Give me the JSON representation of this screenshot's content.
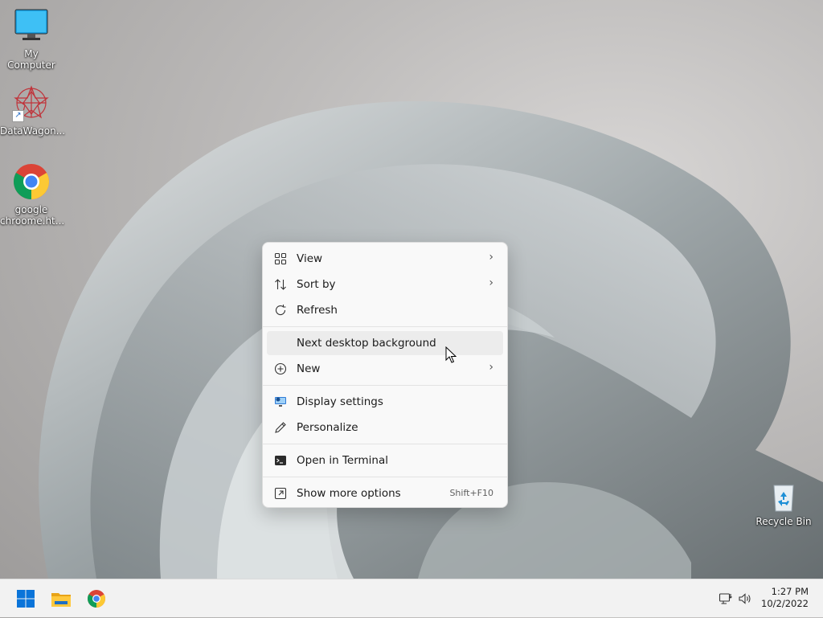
{
  "desktop": {
    "icons": [
      {
        "label": "My Computer",
        "icon": "monitor-icon"
      },
      {
        "label": "DataWagon...",
        "icon": "datawagon-logo-icon"
      },
      {
        "label": "google\nchroome.ht...",
        "label_line1": "google",
        "label_line2": "chroome.ht...",
        "icon": "chrome-icon"
      },
      {
        "label": "Recycle Bin",
        "icon": "recycle-bin-icon"
      }
    ]
  },
  "context_menu": {
    "items": [
      {
        "label": "View",
        "icon": "grid-icon",
        "submenu": true
      },
      {
        "label": "Sort by",
        "icon": "sort-arrows-icon",
        "submenu": true
      },
      {
        "label": "Refresh",
        "icon": "refresh-icon",
        "submenu": false
      },
      {
        "label": "Next desktop background",
        "icon": "",
        "submenu": false,
        "hovered": true
      },
      {
        "label": "New",
        "icon": "plus-circle-icon",
        "submenu": true
      },
      {
        "label": "Display settings",
        "icon": "display-settings-icon",
        "submenu": false
      },
      {
        "label": "Personalize",
        "icon": "pencil-icon",
        "submenu": false
      },
      {
        "label": "Open in Terminal",
        "icon": "terminal-icon",
        "submenu": false
      },
      {
        "label": "Show more options",
        "icon": "expand-icon",
        "shortcut": "Shift+F10"
      }
    ]
  },
  "taskbar": {
    "buttons": [
      {
        "name": "start",
        "icon": "windows-logo-icon"
      },
      {
        "name": "file-explorer",
        "icon": "folder-icon"
      },
      {
        "name": "chrome",
        "icon": "chrome-icon"
      }
    ],
    "tray": {
      "network_icon": "network-icon",
      "volume_icon": "volume-icon"
    },
    "clock": {
      "time": "1:27 PM",
      "date": "10/2/2022"
    }
  },
  "colors": {
    "accent": "#0067c0",
    "menu_bg": "#f9f9f9",
    "taskbar_bg": "#f2f2f2"
  }
}
